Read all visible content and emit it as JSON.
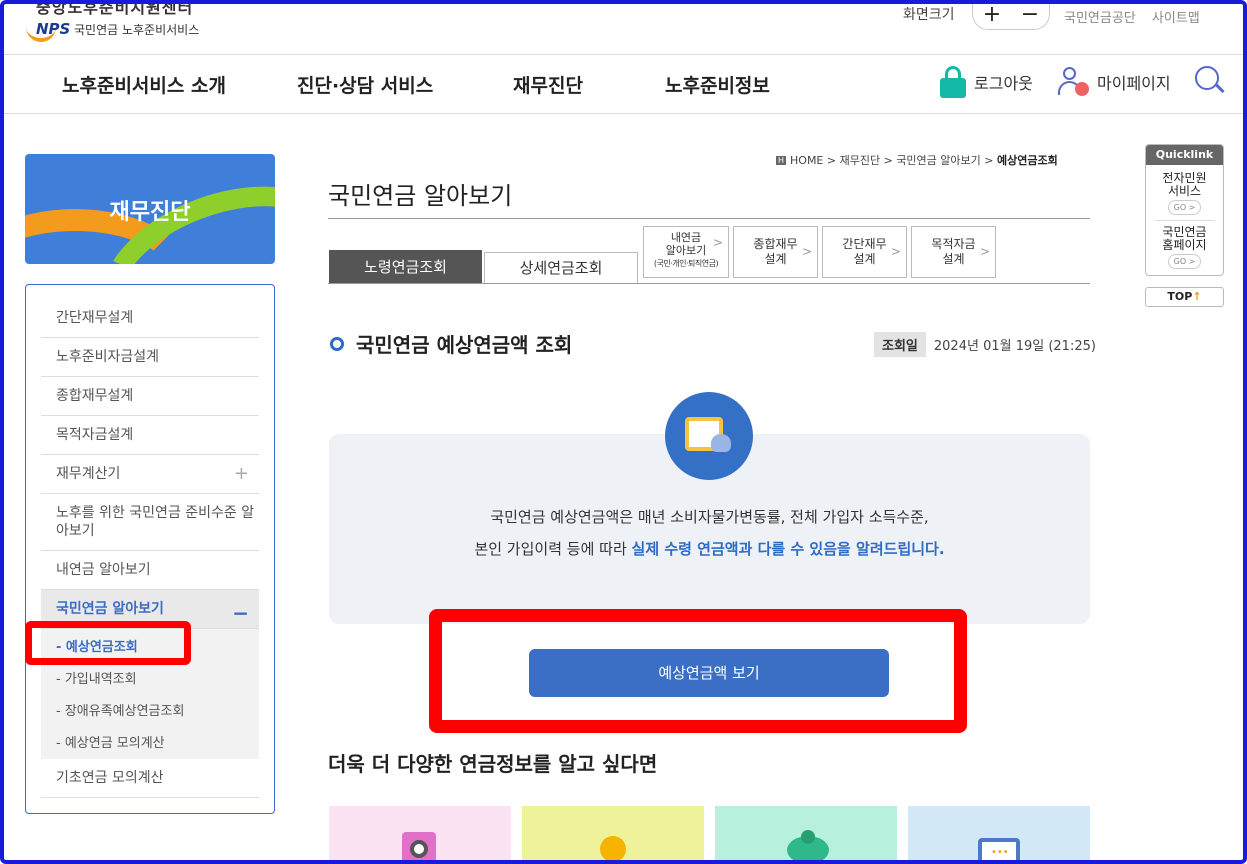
{
  "header": {
    "logo_top": "중앙노후준비지원센터",
    "logo_nps": "NPS",
    "logo_sub": "국민연금 노후준비서비스",
    "font_size_label": "화면크기",
    "zoom_in": "+",
    "zoom_out": "−",
    "links": [
      "국민연금공단",
      "사이트맵"
    ]
  },
  "gnb": {
    "menus": [
      "노후준비서비스 소개",
      "진단·상담 서비스",
      "재무진단",
      "노후준비정보"
    ],
    "logout": "로그아웃",
    "mypage": "마이페이지"
  },
  "sidebar": {
    "banner_title": "재무진단",
    "items": [
      "간단재무설계",
      "노후준비자금설계",
      "종합재무설계",
      "목적자금설계",
      "재무계산기",
      "노후를 위한 국민연금 준비수준 알아보기",
      "내연금 알아보기",
      "국민연금 알아보기",
      "기초연금 모의계산"
    ],
    "subitems": [
      "- 예상연금조회",
      "- 가입내역조회",
      "- 장애유족예상연금조회",
      "- 예상연금 모의계산"
    ],
    "plus": "+",
    "minus": "−"
  },
  "breadcrumb": {
    "home_icon": "H",
    "home": "HOME",
    "sep": ">",
    "c1": "재무진단",
    "c2": "국민연금 알아보기",
    "c3": "예상연금조회"
  },
  "page_title": "국민연금 알아보기",
  "tabs": {
    "t1": "노령연금조회",
    "t2": "상세연금조회",
    "t3_l1": "내연금",
    "t3_l2": "알아보기",
    "t3_l3": "(국민·개인·퇴직연금)",
    "t4_l1": "종합재무",
    "t4_l2": "설계",
    "t5_l1": "간단재무",
    "t5_l2": "설계",
    "t6_l1": "목적자금",
    "t6_l2": "설계",
    "arrow": ">"
  },
  "section": {
    "title": "국민연금 예상연금액 조회",
    "date_label": "조회일",
    "date_value": "2024년 01월 19일 (21:25)"
  },
  "info": {
    "line1": "국민연금 예상연금액은 매년 소비자물가변동률, 전체 가입자 소득수준,",
    "line2_plain": "본인 가입이력 등에 따라 ",
    "line2_highlight": "실제 수령 연금액과 다를 수 있음을 알려드립니다."
  },
  "view_button": "예상연금액 보기",
  "more_title": "더욱 더 다양한 연금정보를 알고 싶다면",
  "cards": [
    {
      "color": "#fbe3f3",
      "icon": "magnifier-icon"
    },
    {
      "color": "#eef29a",
      "icon": "sun-icon"
    },
    {
      "color": "#b7f0dd",
      "icon": "piggy-bank-icon"
    },
    {
      "color": "#d3e8f6",
      "icon": "monitor-icon"
    }
  ],
  "quicklink": {
    "header": "Quicklink",
    "l1a": "전자민원",
    "l1b": "서비스",
    "l2a": "국민연금",
    "l2b": "홈페이지",
    "go": "GO >"
  },
  "top_button": "TOP",
  "top_arrow": "↑",
  "colors": {
    "accent": "#3b6fc5",
    "highlight_box": "#ff0000",
    "frame": "#1a1adc"
  }
}
